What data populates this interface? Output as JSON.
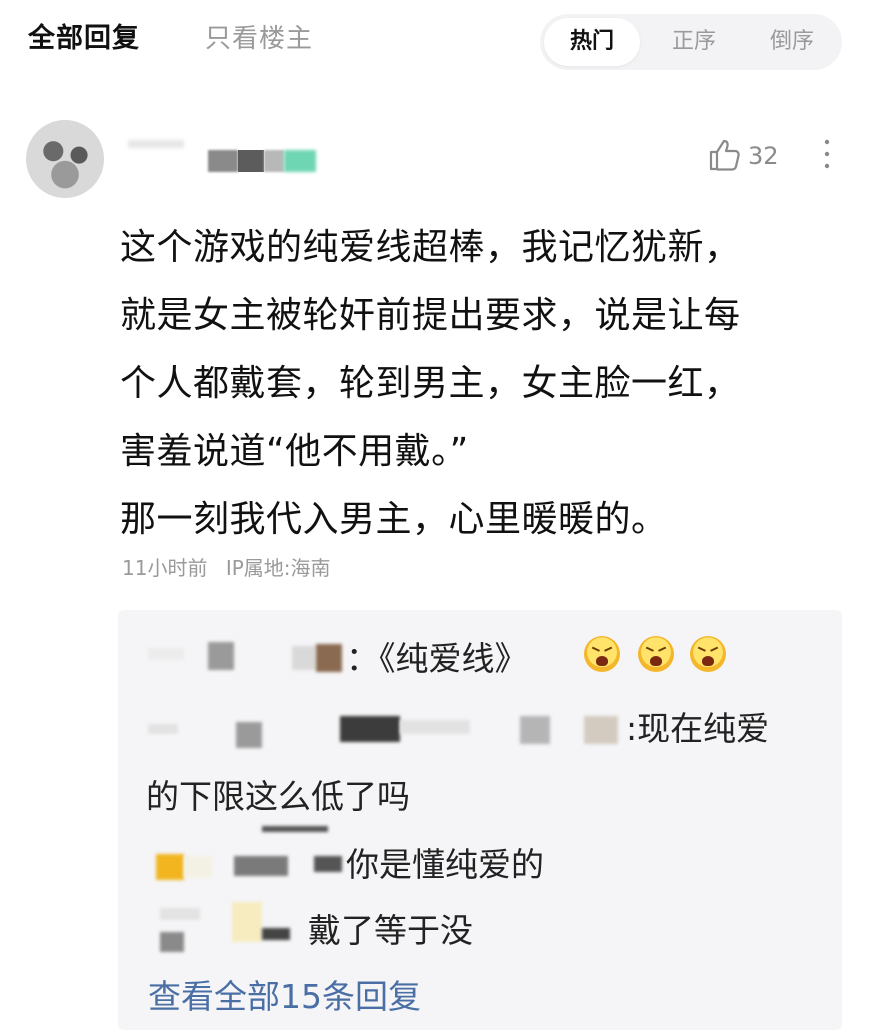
{
  "tabs": {
    "all_replies": "全部回复",
    "only_op": "只看楼主"
  },
  "sort": {
    "hot": "热门",
    "ascending": "正序",
    "descending": "倒序",
    "selected": "热门"
  },
  "comment": {
    "likes": "32",
    "lines": [
      "这个游戏的纯爱线超棒，我记忆犹新，",
      "就是女主被轮奸前提出要求，说是让每",
      "个人都戴套，轮到男主，女主脸一红，",
      "害羞说道“他不用戴。”",
      "那一刻我代入男主，心里暖暖的。"
    ],
    "time": "11小时前",
    "ip": "IP属地:海南"
  },
  "replies": {
    "items": [
      {
        "text": "：《纯爱线》"
      },
      {
        "text": ":现在纯爱"
      },
      {
        "text": "的下限这么低了吗"
      },
      {
        "text": "你是懂纯爱的"
      },
      {
        "text": "戴了等于没"
      }
    ],
    "view_all": "查看全部15条回复"
  },
  "colors": {
    "link": "#4a6fa5",
    "muted": "#9a9a9a",
    "reply_bg": "#f5f5f7"
  },
  "icons": [
    "thumbs-up-icon",
    "more-vertical-icon",
    "emoji-laughing-icon"
  ]
}
